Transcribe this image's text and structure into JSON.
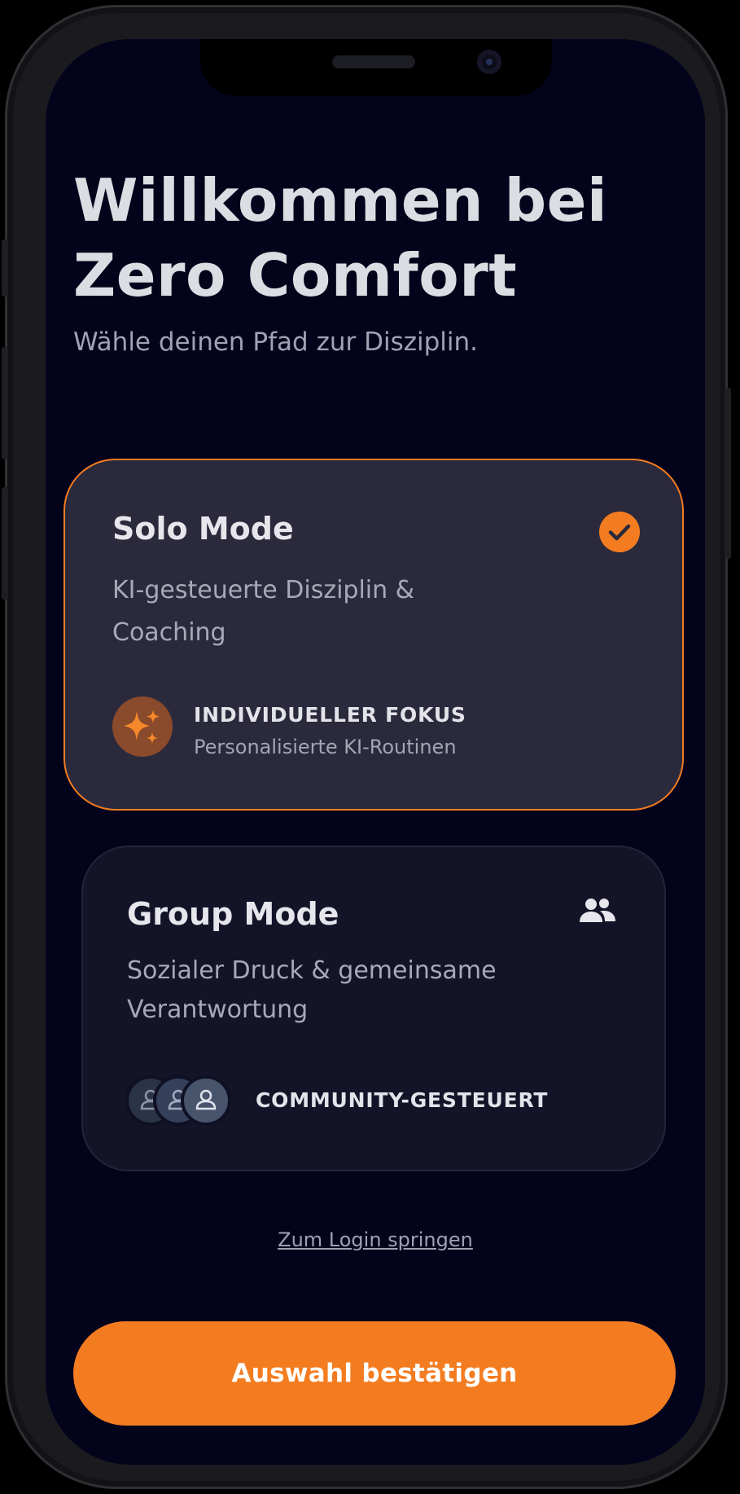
{
  "welcome": {
    "title_line1": "Willkommen bei",
    "title_line2": "Zero Comfort",
    "subtitle": "Wähle deinen Pfad zur Disziplin."
  },
  "solo_card": {
    "title": "Solo Mode",
    "description_line1": "KI-gesteuerte Disziplin &",
    "description_line2": "Coaching",
    "feature_title": "INDIVIDUELLER FOKUS",
    "feature_subtitle": "Personalisierte KI-Routinen",
    "selected": true,
    "icon": "sparkles-icon",
    "status_icon": "check-circle-icon"
  },
  "group_card": {
    "title": "Group Mode",
    "description_line1": "Sozialer Druck & gemeinsame",
    "description_line2": "Verantwortung",
    "feature_title": "COMMUNITY-GESTEUERT",
    "selected": false,
    "icon": "group-icon",
    "avatars": [
      "person-icon",
      "person-icon",
      "person-icon"
    ]
  },
  "links": {
    "login": "Zum Login springen"
  },
  "actions": {
    "confirm": "Auswahl bestätigen"
  },
  "colors": {
    "accent": "#f47c20",
    "background": "#03031c",
    "card_selected": "#2b2a3c",
    "card_default": "#131428"
  }
}
